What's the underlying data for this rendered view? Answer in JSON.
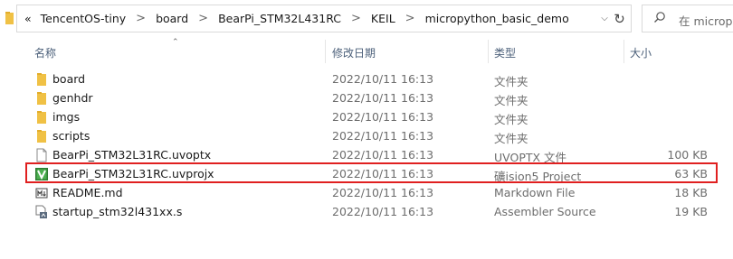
{
  "address_bar": {
    "overflow": "«",
    "breadcrumbs": [
      "TencentOS-tiny",
      "board",
      "BearPi_STM32L431RC",
      "KEIL",
      "micropython_basic_demo"
    ],
    "separator": ">"
  },
  "search": {
    "placeholder": "在 micropy"
  },
  "columns": {
    "name": "名称",
    "date": "修改日期",
    "type": "类型",
    "size": "大小"
  },
  "files": [
    {
      "name": "board",
      "date": "2022/10/11 16:13",
      "type": "文件夹",
      "size": "",
      "icon": "folder-icon"
    },
    {
      "name": "genhdr",
      "date": "2022/10/11 16:13",
      "type": "文件夹",
      "size": "",
      "icon": "folder-icon"
    },
    {
      "name": "imgs",
      "date": "2022/10/11 16:13",
      "type": "文件夹",
      "size": "",
      "icon": "folder-icon"
    },
    {
      "name": "scripts",
      "date": "2022/10/11 16:13",
      "type": "文件夹",
      "size": "",
      "icon": "folder-icon"
    },
    {
      "name": "BearPi_STM32L31RC.uvoptx",
      "date": "2022/10/11 16:13",
      "type": "UVOPTX 文件",
      "size": "100 KB",
      "icon": "document-icon"
    },
    {
      "name": "BearPi_STM32L31RC.uvprojx",
      "date": "2022/10/11 16:13",
      "type": "礦ision5 Project",
      "size": "63 KB",
      "icon": "uvision-project-icon",
      "highlighted": true
    },
    {
      "name": "README.md",
      "date": "2022/10/11 16:13",
      "type": "Markdown File",
      "size": "18 KB",
      "icon": "markdown-file-icon"
    },
    {
      "name": "startup_stm32l431xx.s",
      "date": "2022/10/11 16:13",
      "type": "Assembler Source",
      "size": "19 KB",
      "icon": "assembler-file-icon"
    }
  ],
  "colors": {
    "folder": "#f0c145",
    "highlight": "#e02020",
    "header_text": "#4c607a"
  }
}
